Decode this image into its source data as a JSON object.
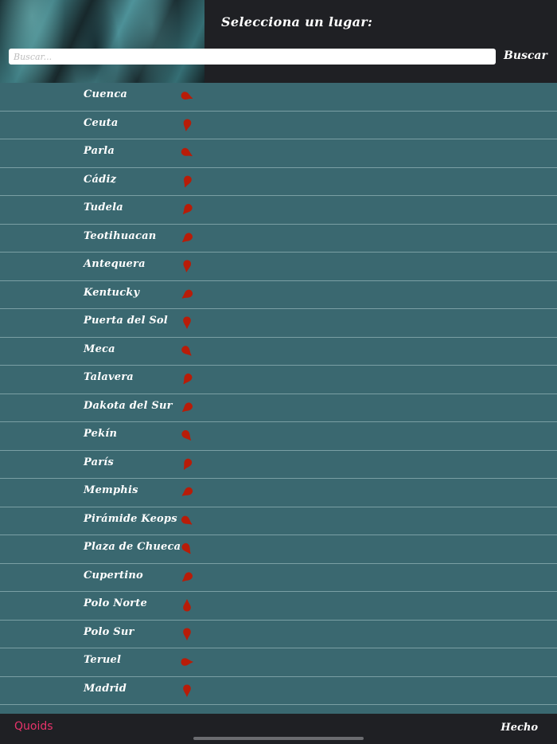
{
  "header": {
    "title": "Selecciona un lugar:",
    "search_placeholder": "Buscar...",
    "search_button_label": "Buscar"
  },
  "places": [
    {
      "label": "Cuenca",
      "pin_rotation": -70
    },
    {
      "label": "Ceuta",
      "pin_rotation": 10
    },
    {
      "label": "Parla",
      "pin_rotation": -60
    },
    {
      "label": "Cádiz",
      "pin_rotation": 20
    },
    {
      "label": "Tudela",
      "pin_rotation": 40
    },
    {
      "label": "Teotihuacan",
      "pin_rotation": 50
    },
    {
      "label": "Antequera",
      "pin_rotation": 5
    },
    {
      "label": "Kentucky",
      "pin_rotation": 55
    },
    {
      "label": "Puerta del Sol",
      "pin_rotation": 0
    },
    {
      "label": "Meca",
      "pin_rotation": -45
    },
    {
      "label": "Talavera",
      "pin_rotation": 35
    },
    {
      "label": "Dakota del Sur",
      "pin_rotation": 50
    },
    {
      "label": "Pekín",
      "pin_rotation": -40
    },
    {
      "label": "París",
      "pin_rotation": 30
    },
    {
      "label": "Memphis",
      "pin_rotation": 55
    },
    {
      "label": "Pirámide Keops",
      "pin_rotation": -55
    },
    {
      "label": "Plaza de Chueca",
      "pin_rotation": -35
    },
    {
      "label": "Cupertino",
      "pin_rotation": 50
    },
    {
      "label": "Polo Norte",
      "pin_rotation": 180
    },
    {
      "label": "Polo Sur",
      "pin_rotation": 0
    },
    {
      "label": "Teruel",
      "pin_rotation": -90
    },
    {
      "label": "Madrid",
      "pin_rotation": 0
    }
  ],
  "bottom_bar": {
    "left_link": "Quoids",
    "done_label": "Hecho"
  },
  "colors": {
    "pin": "#b81c08",
    "accent_link": "#e8336b",
    "list_background": "#3a6870",
    "bar_background": "#1f2024"
  },
  "icons": {
    "pin": "map-pin-icon"
  }
}
